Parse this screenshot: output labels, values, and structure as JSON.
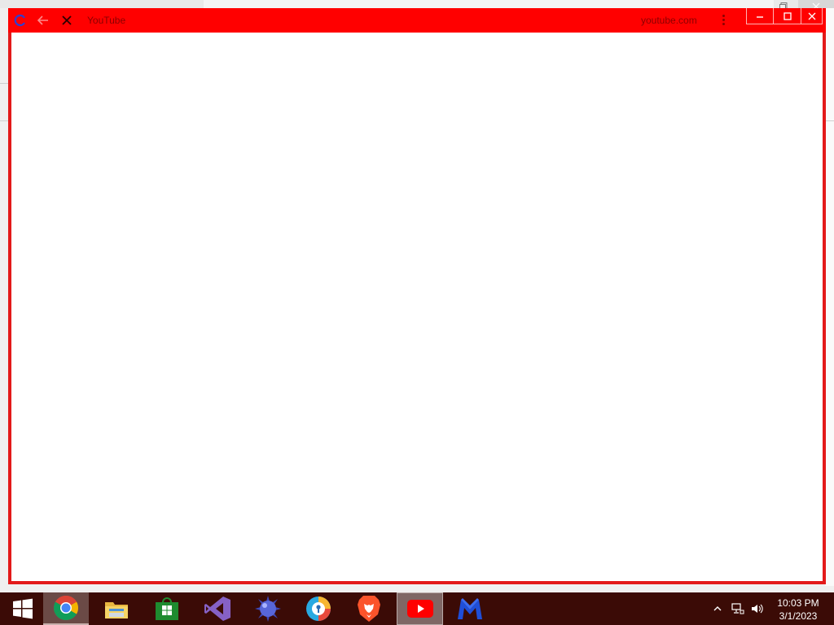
{
  "window": {
    "title": "YouTube",
    "url": "youtube.com",
    "colors": {
      "titlebar": "#ff0000",
      "frame": "#e31a1a",
      "content": "#ffffff"
    },
    "nav_icons": [
      "reload-icon",
      "back-arrow-icon",
      "close-tab-icon"
    ],
    "controls": [
      "minimize-icon",
      "maximize-icon",
      "close-icon"
    ]
  },
  "taskbar": {
    "color": "#3b0b06",
    "apps": [
      {
        "name": "start",
        "icon": "windows-logo-icon"
      },
      {
        "name": "chrome",
        "icon": "chrome-icon",
        "state": "active"
      },
      {
        "name": "file-explorer",
        "icon": "folder-icon"
      },
      {
        "name": "store",
        "icon": "store-icon"
      },
      {
        "name": "visual-studio",
        "icon": "visual-studio-icon"
      },
      {
        "name": "ball-app",
        "icon": "spiked-ball-icon"
      },
      {
        "name": "browser",
        "icon": "browser-icon"
      },
      {
        "name": "brave",
        "icon": "brave-lion-icon"
      },
      {
        "name": "youtube",
        "icon": "youtube-icon",
        "state": "selected"
      },
      {
        "name": "malwarebytes",
        "icon": "malwarebytes-icon"
      }
    ],
    "tray_icons": [
      "show-hidden-icons-chevron",
      "network-icon",
      "volume-icon"
    ],
    "clock": {
      "time": "10:03 PM",
      "date": "3/1/2023"
    }
  }
}
